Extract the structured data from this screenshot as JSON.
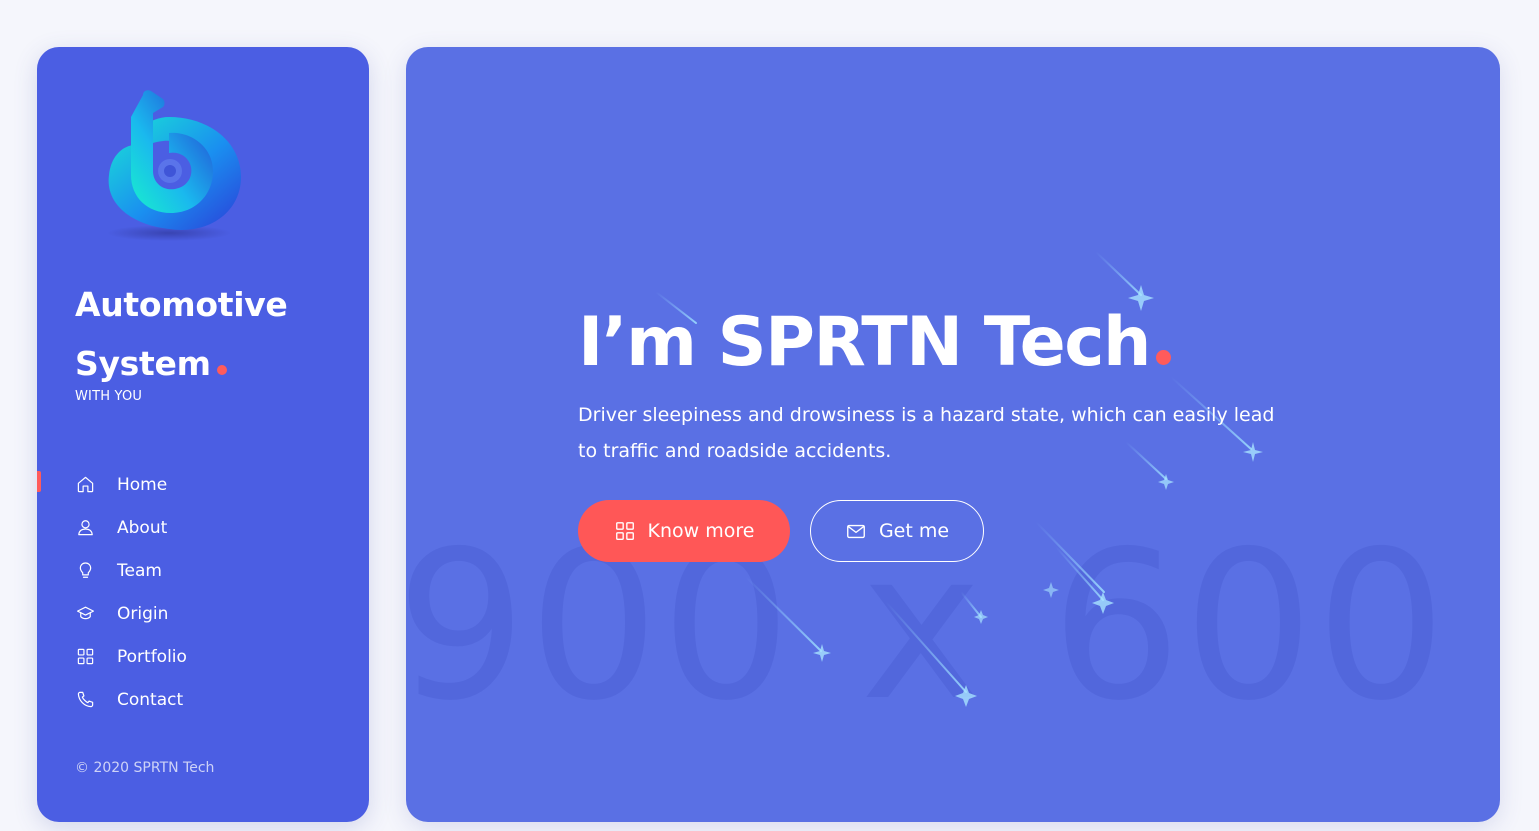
{
  "sidebar": {
    "brand_title_line1": "Automotive",
    "brand_title_line2": "System",
    "tagline": "WITH YOU",
    "nav": [
      {
        "label": "Home",
        "icon": "home-icon",
        "active": true
      },
      {
        "label": "About",
        "icon": "user-icon",
        "active": false
      },
      {
        "label": "Team",
        "icon": "lightbulb-icon",
        "active": false
      },
      {
        "label": "Origin",
        "icon": "graduation-cap-icon",
        "active": false
      },
      {
        "label": "Portfolio",
        "icon": "grid-icon",
        "active": false
      },
      {
        "label": "Contact",
        "icon": "phone-icon",
        "active": false
      }
    ],
    "copyright": "© 2020 SPRTN Tech"
  },
  "hero": {
    "title": "I’m SPRTN Tech",
    "description": "Driver sleepiness and drowsiness is a hazard state, which can easily lead to traffic and roadside accidents.",
    "placeholder_text": "900 x 600",
    "primary_button": {
      "label": "Know more",
      "icon": "grid-icon"
    },
    "secondary_button": {
      "label": "Get me",
      "icon": "mail-icon"
    }
  },
  "colors": {
    "sidebar_bg": "#4b5ee3",
    "hero_bg": "#5a70e4",
    "accent": "#ff5b5b",
    "page_bg": "#f5f6fc"
  }
}
